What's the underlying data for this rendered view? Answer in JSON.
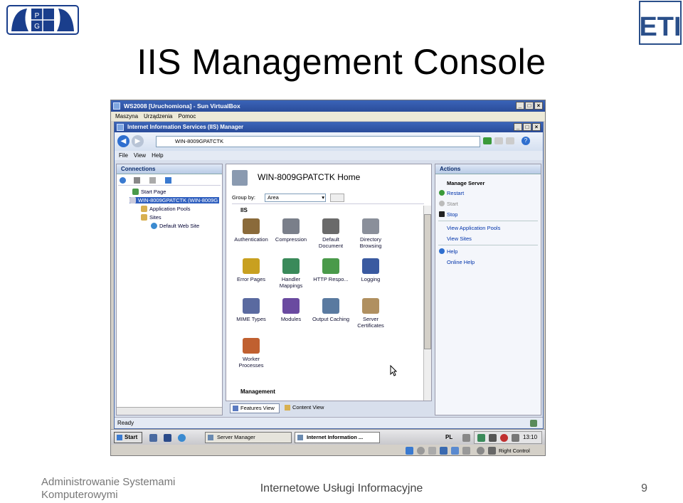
{
  "slide": {
    "title": "IIS Management Console",
    "footer_left": "Administrowanie Systemami Komputerowymi",
    "footer_center": "Internetowe Usługi Informacyjne",
    "page_number": "9",
    "logo_left_letters": [
      "P",
      "G"
    ],
    "logo_right_text": "ETI"
  },
  "vbox": {
    "title": "WS2008 [Uruchomiona] - Sun VirtualBox",
    "menu": [
      "Maszyna",
      "Urządzenia",
      "Pomoc"
    ],
    "status_right": "Right Control"
  },
  "iis": {
    "title": "Internet Information Services (IIS) Manager",
    "address": "WIN-8009GPATCTK",
    "menu": [
      "File",
      "View",
      "Help"
    ],
    "connections": {
      "header": "Connections",
      "tree": [
        "Start Page",
        "WIN-8009GPATCTK (WIN-8009G",
        "Application Pools",
        "Sites",
        "Default Web Site"
      ]
    },
    "center": {
      "heading": "WIN-8009GPATCTK Home",
      "group_by_label": "Group by:",
      "group_by_value": "Area",
      "section": "IIS",
      "section2": "Management",
      "features": [
        {
          "label": "Authentication",
          "icon": "authentication-icon",
          "color": "#8a6a3a"
        },
        {
          "label": "Compression",
          "icon": "compression-icon",
          "color": "#7a7f8a"
        },
        {
          "label": "Default Document",
          "icon": "default-document-icon",
          "color": "#6a6a6a"
        },
        {
          "label": "Directory Browsing",
          "icon": "directory-browsing-icon",
          "color": "#8a8f9a"
        },
        {
          "label": "Error Pages",
          "icon": "error-pages-icon",
          "color": "#c8a020"
        },
        {
          "label": "Handler Mappings",
          "icon": "handler-mappings-icon",
          "color": "#3a8a5a"
        },
        {
          "label": "HTTP Respo...",
          "icon": "http-response-icon",
          "color": "#4a9a4a"
        },
        {
          "label": "Logging",
          "icon": "logging-icon",
          "color": "#3a5aa0"
        },
        {
          "label": "MIME Types",
          "icon": "mime-types-icon",
          "color": "#5a6aa0"
        },
        {
          "label": "Modules",
          "icon": "modules-icon",
          "color": "#6a4aa0"
        },
        {
          "label": "Output Caching",
          "icon": "output-caching-icon",
          "color": "#5a7aa0"
        },
        {
          "label": "Server Certificates",
          "icon": "server-certificates-icon",
          "color": "#b09060"
        },
        {
          "label": "Worker Processes",
          "icon": "worker-processes-icon",
          "color": "#c06030"
        }
      ],
      "tabs": [
        "Features View",
        "Content View"
      ]
    },
    "actions": {
      "header": "Actions",
      "group": "Manage Server",
      "items": [
        "Restart",
        "Start",
        "Stop",
        "View Application Pools",
        "View Sites",
        "Help",
        "Online Help"
      ]
    },
    "status": "Ready"
  },
  "taskbar": {
    "start": "Start",
    "items": [
      "Server Manager",
      "Internet Information ..."
    ],
    "lang": "PL",
    "clock": "13:10"
  }
}
